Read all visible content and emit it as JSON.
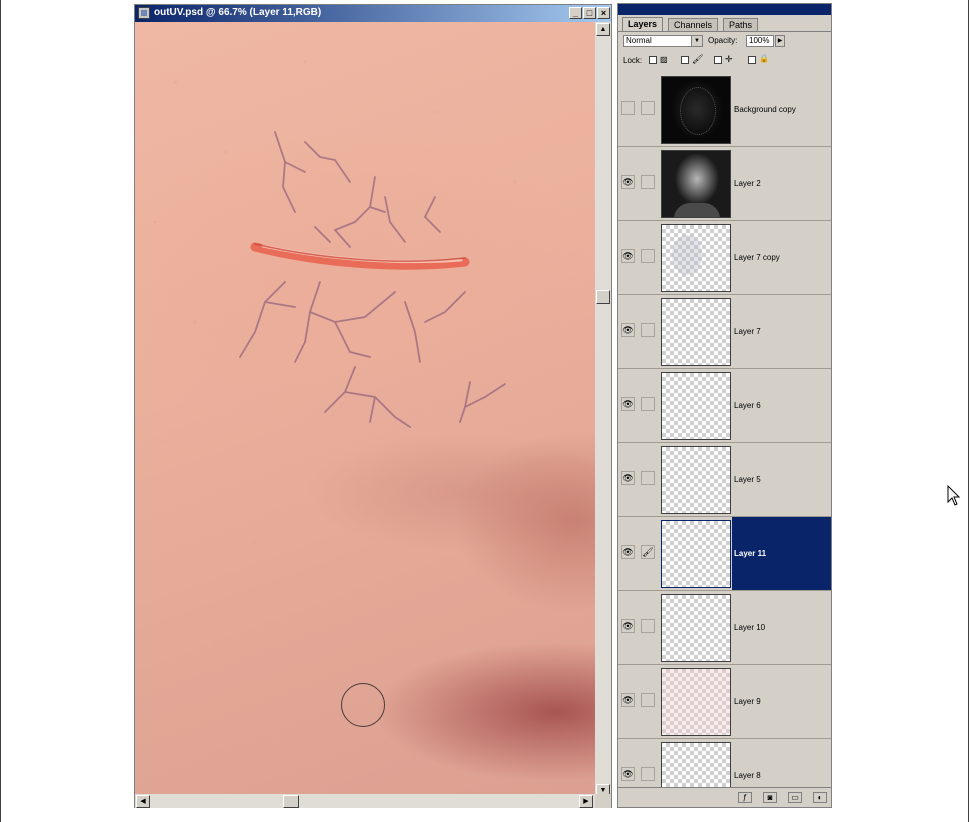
{
  "document_window": {
    "title": "outUV.psd @ 66.7% (Layer 11,RGB)",
    "buttons": {
      "minimize": "_",
      "maximize": "□",
      "close": "×"
    }
  },
  "scrollbars": {
    "up_arrow": "▲",
    "down_arrow": "▼",
    "left_arrow": "◀",
    "right_arrow": "▶"
  },
  "layers_panel": {
    "tabs": [
      {
        "label": "Layers",
        "active": true
      },
      {
        "label": "Channels",
        "active": false
      },
      {
        "label": "Paths",
        "active": false
      }
    ],
    "blend_mode": "Normal",
    "opacity_label": "Opacity:",
    "opacity_value": "100%",
    "lock_label": "Lock:",
    "layers": [
      {
        "name": "Background copy",
        "visible": false,
        "selected": false,
        "thumbnail": "dark-face-outline"
      },
      {
        "name": "Layer 2",
        "visible": true,
        "selected": false,
        "thumbnail": "grey-face-render"
      },
      {
        "name": "Layer 7 copy",
        "visible": true,
        "selected": false,
        "thumbnail": "faint-transparent"
      },
      {
        "name": "Layer 7",
        "visible": true,
        "selected": false,
        "thumbnail": "transparent"
      },
      {
        "name": "Layer 6",
        "visible": true,
        "selected": false,
        "thumbnail": "transparent"
      },
      {
        "name": "Layer 5",
        "visible": true,
        "selected": false,
        "thumbnail": "transparent"
      },
      {
        "name": "Layer 11",
        "visible": true,
        "selected": true,
        "thumbnail": "transparent"
      },
      {
        "name": "Layer 10",
        "visible": true,
        "selected": false,
        "thumbnail": "transparent"
      },
      {
        "name": "Layer 9",
        "visible": true,
        "selected": false,
        "thumbnail": "pinkish-transparent"
      },
      {
        "name": "Layer 8",
        "visible": true,
        "selected": false,
        "thumbnail": "transparent"
      }
    ],
    "icons": {
      "eye": "👁",
      "brush": "🖌",
      "lock_move": "✛",
      "lock_all": "🔒",
      "effects": "ƒ",
      "mask": "◙",
      "folder": "▭",
      "adjust": "◐"
    }
  },
  "colors": {
    "titlebar_start": "#0a246a",
    "titlebar_end": "#a6caf0",
    "selection": "#0a246a",
    "chrome": "#d4d0c8"
  }
}
